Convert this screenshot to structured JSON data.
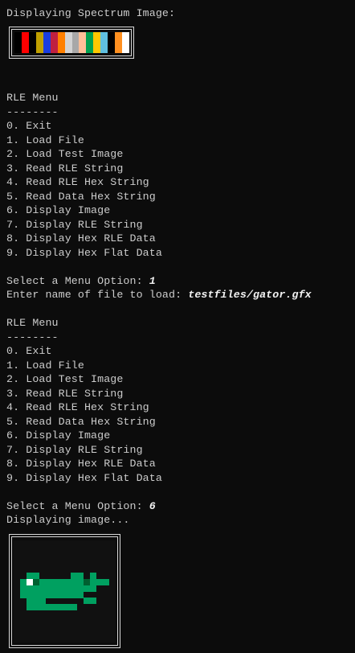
{
  "spectrum_header": "Displaying Spectrum Image:",
  "spectrum_colors": [
    "#000000",
    "#ff0000",
    "#000000",
    "#c0a000",
    "#1a3ee0",
    "#c02040",
    "#ff8000",
    "#d3d3d3",
    "#a8a8a8",
    "#ffbf98",
    "#00a050",
    "#ffc800",
    "#60c0e0",
    "#000000",
    "#ff9020",
    "#ffffff"
  ],
  "menu1": {
    "title": "RLE Menu",
    "separator": "--------",
    "options": [
      "0. Exit",
      "1. Load File",
      "2. Load Test Image",
      "3. Read RLE String",
      "4. Read RLE Hex String",
      "5. Read Data Hex String",
      "6. Display Image",
      "7. Display RLE String",
      "8. Display Hex RLE Data",
      "9. Display Hex Flat Data"
    ]
  },
  "prompt1": {
    "label": "Select a Menu Option: ",
    "value": "1"
  },
  "file_prompt": {
    "label": "Enter name of file to load: ",
    "value": "testfiles/gator.gfx"
  },
  "menu2": {
    "title": "RLE Menu",
    "separator": "--------",
    "options": [
      "0. Exit",
      "1. Load File",
      "2. Load Test Image",
      "3. Read RLE String",
      "4. Read RLE Hex String",
      "5. Read Data Hex String",
      "6. Display Image",
      "7. Display RLE String",
      "8. Display Hex RLE Data",
      "9. Display Hex Flat Data"
    ]
  },
  "prompt2": {
    "label": "Select a Menu Option: ",
    "value": "6"
  },
  "display_msg": "Displaying image...",
  "gator_colors": {
    "background": "#111111",
    "body": "#00a060",
    "eye_white": "#ffffff",
    "dark_spot": "#006030"
  }
}
